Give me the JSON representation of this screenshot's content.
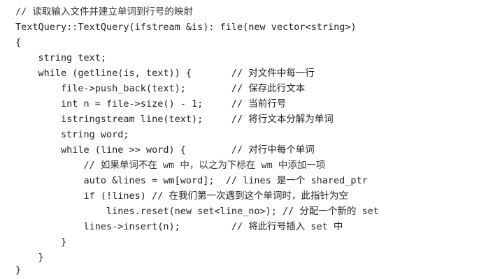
{
  "lines": [
    "// 读取输入文件并建立单词到行号的映射",
    "TextQuery::TextQuery(ifstream &is): file(new vector<string>)",
    "{",
    "    string text;",
    "    while (getline(is, text)) {       // 对文件中每一行",
    "        file->push_back(text);        // 保存此行文本",
    "        int n = file->size() - 1;     // 当前行号",
    "        istringstream line(text);     // 将行文本分解为单词",
    "        string word;",
    "        while (line >> word) {        // 对行中每个单词",
    "            // 如果单词不在 wm 中，以之为下标在 wm 中添加一项",
    "            auto &lines = wm[word];  // lines 是一个 shared_ptr",
    "            if (!lines) // 在我们第一次遇到这个单词时，此指针为空",
    "                lines.reset(new set<line_no>); // 分配一个新的 set",
    "            lines->insert(n);         // 将此行号插入 set 中",
    "        }",
    "    }",
    "}"
  ]
}
